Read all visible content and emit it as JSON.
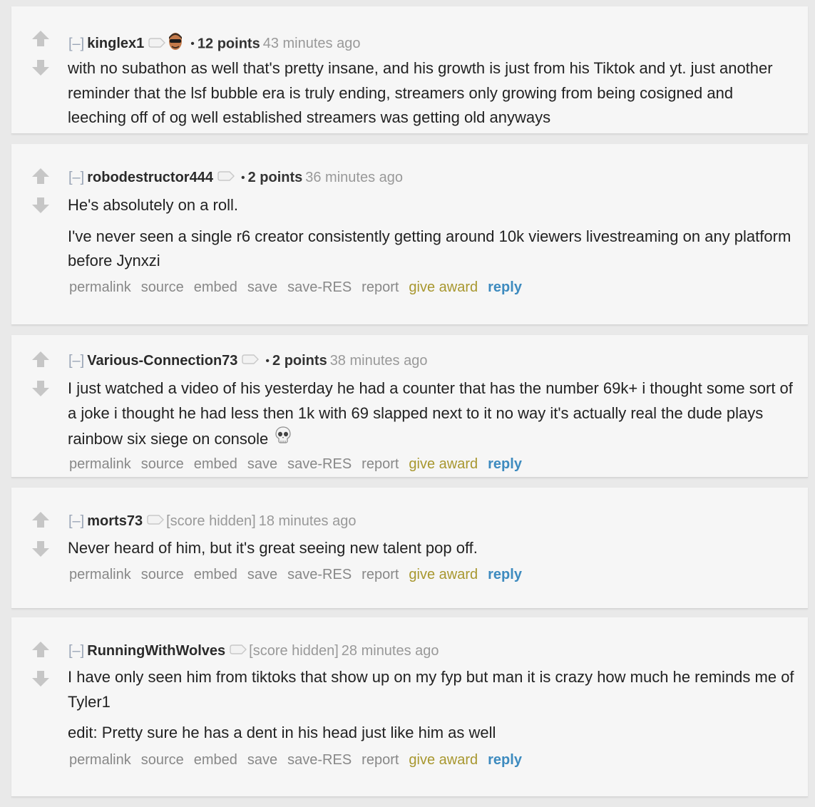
{
  "comments": [
    {
      "author": "kinglex1",
      "collapse": "[–]",
      "score": "12 points",
      "time": "43 minutes ago",
      "has_flair_avatar": true,
      "paragraphs": [
        "with no subathon as well that's pretty insane, and his growth is just from his Tiktok and yt. just another reminder that the lsf bubble era is truly ending, streamers only growing from being cosigned and leeching off of og well established streamers was getting old anyways"
      ]
    },
    {
      "author": "robodestructor444",
      "collapse": "[–]",
      "score": "2 points",
      "time": "36 minutes ago",
      "paragraphs": [
        "He's absolutely on a roll.",
        "I've never seen a single r6 creator consistently getting around 10k viewers livestreaming on any platform before Jynxzi"
      ]
    },
    {
      "author": "Various-Connection73",
      "collapse": "[–]",
      "score": "2 points",
      "time": "38 minutes ago",
      "paragraphs": [
        "I just watched a video of his yesterday he had a counter that has the number 69k+ i thought some sort of a joke i thought he had less then 1k with 69 slapped next to it no way it's actually real the dude plays rainbow six siege on console"
      ],
      "emoji": "skull-icon"
    },
    {
      "author": "morts73",
      "collapse": "[–]",
      "score": "[score hidden]",
      "time": "18 minutes ago",
      "paragraphs": [
        "Never heard of him, but it's great seeing new talent pop off."
      ]
    },
    {
      "author": "RunningWithWolves",
      "collapse": "[–]",
      "score": "[score hidden]",
      "time": "28 minutes ago",
      "paragraphs": [
        "I have only seen him from tiktoks that show up on my fyp but man it is crazy how much he reminds me of Tyler1",
        "edit: Pretty sure he has a dent in his head just like him as well"
      ]
    }
  ],
  "buttons": {
    "permalink": "permalink",
    "source": "source",
    "embed": "embed",
    "save": "save",
    "save_res": "save-RES",
    "report": "report",
    "give_award": "give award",
    "reply": "reply"
  },
  "colors": {
    "page_bg": "#e9e9e9",
    "card_bg": "#f6f6f6",
    "author": "#2a2a2a",
    "give_award": "#a8972f",
    "reply": "#3e8bbf"
  }
}
